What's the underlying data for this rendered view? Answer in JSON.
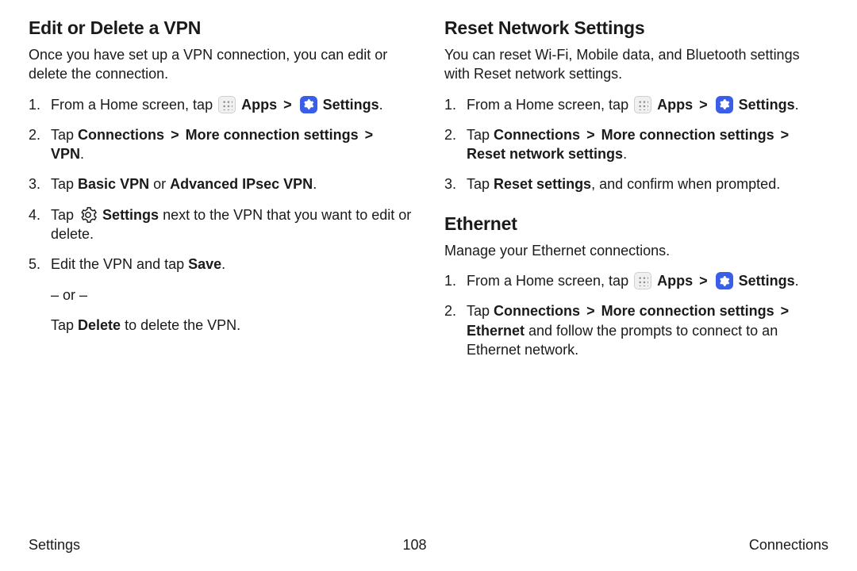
{
  "left": {
    "heading": "Edit or Delete a VPN",
    "intro": "Once you have set up a VPN connection, you can edit or delete the connection.",
    "step1_pre": "From a Home screen, tap ",
    "apps": "Apps",
    "settings": "Settings",
    "step2_pre": "Tap ",
    "step2_a": "Connections",
    "step2_b": "More connection settings",
    "step2_c": "VPN",
    "step3_pre": "Tap ",
    "step3_a": "Basic VPN",
    "step3_or": " or ",
    "step3_b": "Advanced IPsec VPN",
    "step4_pre": "Tap ",
    "step4_settings": "Settings",
    "step4_post": " next to the VPN that you want to edit or delete.",
    "step5_pre": "Edit the VPN and tap ",
    "step5_save": "Save",
    "step5_or": "– or –",
    "step5_del_pre": "Tap ",
    "step5_del": "Delete",
    "step5_del_post": " to delete the VPN."
  },
  "right": {
    "heading1": "Reset Network Settings",
    "intro1": "You can reset Wi-Fi, Mobile data, and Bluetooth settings with Reset network settings.",
    "r1_step1_pre": "From a Home screen, tap ",
    "apps": "Apps",
    "settings": "Settings",
    "r1_step2_pre": "Tap ",
    "r1_step2_a": "Connections",
    "r1_step2_b": "More connection settings",
    "r1_step2_c": "Reset network settings",
    "r1_step3_pre": "Tap ",
    "r1_step3_a": "Reset settings",
    "r1_step3_post": ", and confirm when prompted.",
    "heading2": "Ethernet",
    "intro2": "Manage your Ethernet connections.",
    "r2_step1_pre": "From a Home screen, tap ",
    "r2_step2_pre": "Tap ",
    "r2_step2_a": "Connections",
    "r2_step2_b": "More connection settings",
    "r2_step2_c": "Ethernet",
    "r2_step2_post": " and follow the prompts to connect to an Ethernet network."
  },
  "footer": {
    "left": "Settings",
    "center": "108",
    "right": "Connections"
  },
  "chev": ">",
  "period": "."
}
